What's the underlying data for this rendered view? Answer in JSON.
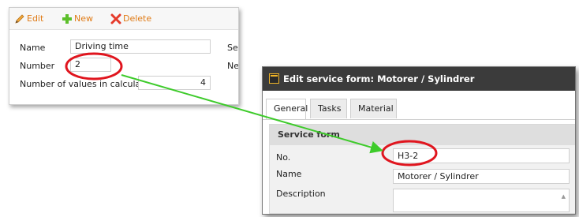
{
  "toolbar": {
    "edit_label": "Edit",
    "new_label": "New",
    "delete_label": "Delete"
  },
  "left_form": {
    "name_label": "Name",
    "name_value": "Driving time",
    "number_label": "Number",
    "number_value": "2",
    "values_label": "Number of values in calculation",
    "values_value": "4",
    "right_label_1": "Ser",
    "right_label_2": "Ne:"
  },
  "dialog": {
    "title": "Edit service form: Motorer / Sylindrer",
    "tabs": [
      {
        "label": "General"
      },
      {
        "label": "Tasks"
      },
      {
        "label": "Material"
      }
    ],
    "section_title": "Service form",
    "no_label": "No.",
    "no_value": "H3-2",
    "name_label": "Name",
    "name_value": "Motorer / Sylindrer",
    "description_label": "Description"
  },
  "colors": {
    "highlight_circle": "#e0151e",
    "arrow": "#3ecb2b",
    "toolbar_text": "#e07b16",
    "dialog_title_bg": "#3b3b3b"
  },
  "icons": {
    "edit": "pencil-icon",
    "new": "plus-icon",
    "delete": "x-icon",
    "dialog": "window-icon"
  }
}
